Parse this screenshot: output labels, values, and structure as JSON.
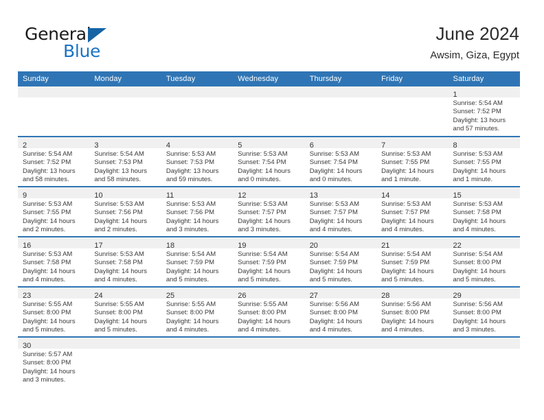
{
  "brand": {
    "word_top": "General",
    "word_bottom": "Blue",
    "triangle_icon": "triangle-right-icon",
    "accent_color": "#1a73c4"
  },
  "header": {
    "title": "June 2024",
    "subtitle": "Awsim, Giza, Egypt"
  },
  "theme": {
    "header_blue": "#2f75b5",
    "daynum_band": "#f0f0f0",
    "row_rule": "#2f75b5",
    "text": "#3a3a3a"
  },
  "weekday_headers": [
    "Sunday",
    "Monday",
    "Tuesday",
    "Wednesday",
    "Thursday",
    "Friday",
    "Saturday"
  ],
  "weeks": [
    [
      {
        "empty": true
      },
      {
        "empty": true
      },
      {
        "empty": true
      },
      {
        "empty": true
      },
      {
        "empty": true
      },
      {
        "empty": true
      },
      {
        "day": "1",
        "sunrise": "Sunrise: 5:54 AM",
        "sunset": "Sunset: 7:52 PM",
        "daylight1": "Daylight: 13 hours",
        "daylight2": "and 57 minutes."
      }
    ],
    [
      {
        "day": "2",
        "sunrise": "Sunrise: 5:54 AM",
        "sunset": "Sunset: 7:52 PM",
        "daylight1": "Daylight: 13 hours",
        "daylight2": "and 58 minutes."
      },
      {
        "day": "3",
        "sunrise": "Sunrise: 5:54 AM",
        "sunset": "Sunset: 7:53 PM",
        "daylight1": "Daylight: 13 hours",
        "daylight2": "and 58 minutes."
      },
      {
        "day": "4",
        "sunrise": "Sunrise: 5:53 AM",
        "sunset": "Sunset: 7:53 PM",
        "daylight1": "Daylight: 13 hours",
        "daylight2": "and 59 minutes."
      },
      {
        "day": "5",
        "sunrise": "Sunrise: 5:53 AM",
        "sunset": "Sunset: 7:54 PM",
        "daylight1": "Daylight: 14 hours",
        "daylight2": "and 0 minutes."
      },
      {
        "day": "6",
        "sunrise": "Sunrise: 5:53 AM",
        "sunset": "Sunset: 7:54 PM",
        "daylight1": "Daylight: 14 hours",
        "daylight2": "and 0 minutes."
      },
      {
        "day": "7",
        "sunrise": "Sunrise: 5:53 AM",
        "sunset": "Sunset: 7:55 PM",
        "daylight1": "Daylight: 14 hours",
        "daylight2": "and 1 minute."
      },
      {
        "day": "8",
        "sunrise": "Sunrise: 5:53 AM",
        "sunset": "Sunset: 7:55 PM",
        "daylight1": "Daylight: 14 hours",
        "daylight2": "and 1 minute."
      }
    ],
    [
      {
        "day": "9",
        "sunrise": "Sunrise: 5:53 AM",
        "sunset": "Sunset: 7:55 PM",
        "daylight1": "Daylight: 14 hours",
        "daylight2": "and 2 minutes."
      },
      {
        "day": "10",
        "sunrise": "Sunrise: 5:53 AM",
        "sunset": "Sunset: 7:56 PM",
        "daylight1": "Daylight: 14 hours",
        "daylight2": "and 2 minutes."
      },
      {
        "day": "11",
        "sunrise": "Sunrise: 5:53 AM",
        "sunset": "Sunset: 7:56 PM",
        "daylight1": "Daylight: 14 hours",
        "daylight2": "and 3 minutes."
      },
      {
        "day": "12",
        "sunrise": "Sunrise: 5:53 AM",
        "sunset": "Sunset: 7:57 PM",
        "daylight1": "Daylight: 14 hours",
        "daylight2": "and 3 minutes."
      },
      {
        "day": "13",
        "sunrise": "Sunrise: 5:53 AM",
        "sunset": "Sunset: 7:57 PM",
        "daylight1": "Daylight: 14 hours",
        "daylight2": "and 4 minutes."
      },
      {
        "day": "14",
        "sunrise": "Sunrise: 5:53 AM",
        "sunset": "Sunset: 7:57 PM",
        "daylight1": "Daylight: 14 hours",
        "daylight2": "and 4 minutes."
      },
      {
        "day": "15",
        "sunrise": "Sunrise: 5:53 AM",
        "sunset": "Sunset: 7:58 PM",
        "daylight1": "Daylight: 14 hours",
        "daylight2": "and 4 minutes."
      }
    ],
    [
      {
        "day": "16",
        "sunrise": "Sunrise: 5:53 AM",
        "sunset": "Sunset: 7:58 PM",
        "daylight1": "Daylight: 14 hours",
        "daylight2": "and 4 minutes."
      },
      {
        "day": "17",
        "sunrise": "Sunrise: 5:53 AM",
        "sunset": "Sunset: 7:58 PM",
        "daylight1": "Daylight: 14 hours",
        "daylight2": "and 4 minutes."
      },
      {
        "day": "18",
        "sunrise": "Sunrise: 5:54 AM",
        "sunset": "Sunset: 7:59 PM",
        "daylight1": "Daylight: 14 hours",
        "daylight2": "and 5 minutes."
      },
      {
        "day": "19",
        "sunrise": "Sunrise: 5:54 AM",
        "sunset": "Sunset: 7:59 PM",
        "daylight1": "Daylight: 14 hours",
        "daylight2": "and 5 minutes."
      },
      {
        "day": "20",
        "sunrise": "Sunrise: 5:54 AM",
        "sunset": "Sunset: 7:59 PM",
        "daylight1": "Daylight: 14 hours",
        "daylight2": "and 5 minutes."
      },
      {
        "day": "21",
        "sunrise": "Sunrise: 5:54 AM",
        "sunset": "Sunset: 7:59 PM",
        "daylight1": "Daylight: 14 hours",
        "daylight2": "and 5 minutes."
      },
      {
        "day": "22",
        "sunrise": "Sunrise: 5:54 AM",
        "sunset": "Sunset: 8:00 PM",
        "daylight1": "Daylight: 14 hours",
        "daylight2": "and 5 minutes."
      }
    ],
    [
      {
        "day": "23",
        "sunrise": "Sunrise: 5:55 AM",
        "sunset": "Sunset: 8:00 PM",
        "daylight1": "Daylight: 14 hours",
        "daylight2": "and 5 minutes."
      },
      {
        "day": "24",
        "sunrise": "Sunrise: 5:55 AM",
        "sunset": "Sunset: 8:00 PM",
        "daylight1": "Daylight: 14 hours",
        "daylight2": "and 5 minutes."
      },
      {
        "day": "25",
        "sunrise": "Sunrise: 5:55 AM",
        "sunset": "Sunset: 8:00 PM",
        "daylight1": "Daylight: 14 hours",
        "daylight2": "and 4 minutes."
      },
      {
        "day": "26",
        "sunrise": "Sunrise: 5:55 AM",
        "sunset": "Sunset: 8:00 PM",
        "daylight1": "Daylight: 14 hours",
        "daylight2": "and 4 minutes."
      },
      {
        "day": "27",
        "sunrise": "Sunrise: 5:56 AM",
        "sunset": "Sunset: 8:00 PM",
        "daylight1": "Daylight: 14 hours",
        "daylight2": "and 4 minutes."
      },
      {
        "day": "28",
        "sunrise": "Sunrise: 5:56 AM",
        "sunset": "Sunset: 8:00 PM",
        "daylight1": "Daylight: 14 hours",
        "daylight2": "and 4 minutes."
      },
      {
        "day": "29",
        "sunrise": "Sunrise: 5:56 AM",
        "sunset": "Sunset: 8:00 PM",
        "daylight1": "Daylight: 14 hours",
        "daylight2": "and 3 minutes."
      }
    ],
    [
      {
        "day": "30",
        "sunrise": "Sunrise: 5:57 AM",
        "sunset": "Sunset: 8:00 PM",
        "daylight1": "Daylight: 14 hours",
        "daylight2": "and 3 minutes."
      },
      {
        "empty": true
      },
      {
        "empty": true
      },
      {
        "empty": true
      },
      {
        "empty": true
      },
      {
        "empty": true
      },
      {
        "empty": true
      }
    ]
  ]
}
